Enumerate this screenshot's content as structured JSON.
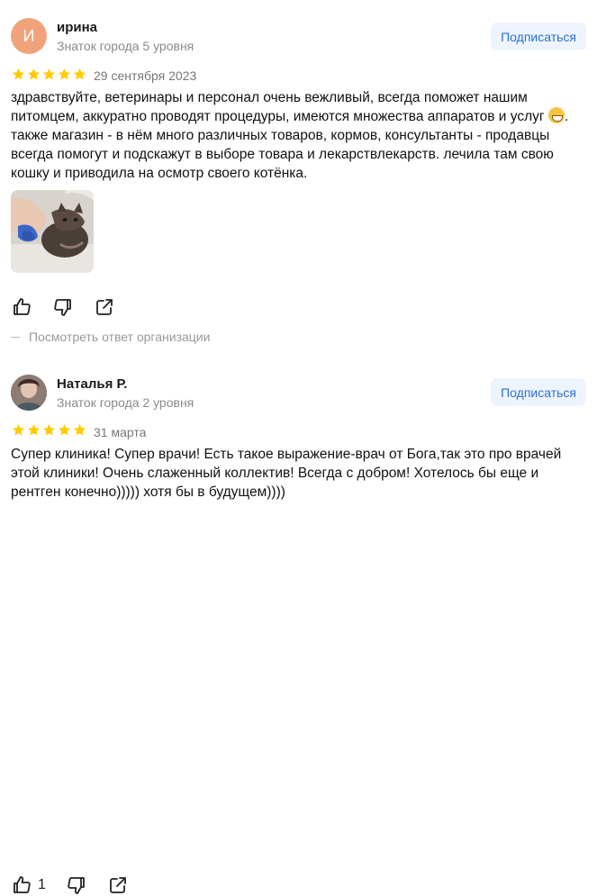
{
  "reviews": [
    {
      "avatar_letter": "И",
      "name": "ирина",
      "level": "Знаток города 5 уровня",
      "subscribe_label": "Подписаться",
      "rating": 5,
      "date": "29 сентября 2023",
      "text_part1": "здравствуйте, ветеринары и персонал очень вежливый, всегда поможет нашим питомцем, аккуратно проводят процедуры, имеются множества аппаратов и услуг ",
      "text_part2": ". также магазин - в нём много различных товаров, кормов, консультанты - продавцы всегда помогут и подскажут в выборе товара и лекарствлекарств. лечила там свою кошку и приводила на осмотр своего котёнка.",
      "org_answer_label": "Посмотреть ответ организации"
    },
    {
      "name": "Наталья Р.",
      "level": "Знаток города 2 уровня",
      "subscribe_label": "Подписаться",
      "rating": 5,
      "date": "31 марта",
      "text": "Супер клиника! Супер врачи! Есть такое выражение-врач от Бога,так это про врачей этой клиники! Очень слаженный коллектив! Всегда с добром! Хотелось бы еще и рентген конечно))))) хотя бы в будущем))))",
      "like_count": "1"
    }
  ],
  "colors": {
    "star": "#fc0",
    "subscribe_bg": "#eef4fd",
    "subscribe_text": "#2c6fd6"
  }
}
